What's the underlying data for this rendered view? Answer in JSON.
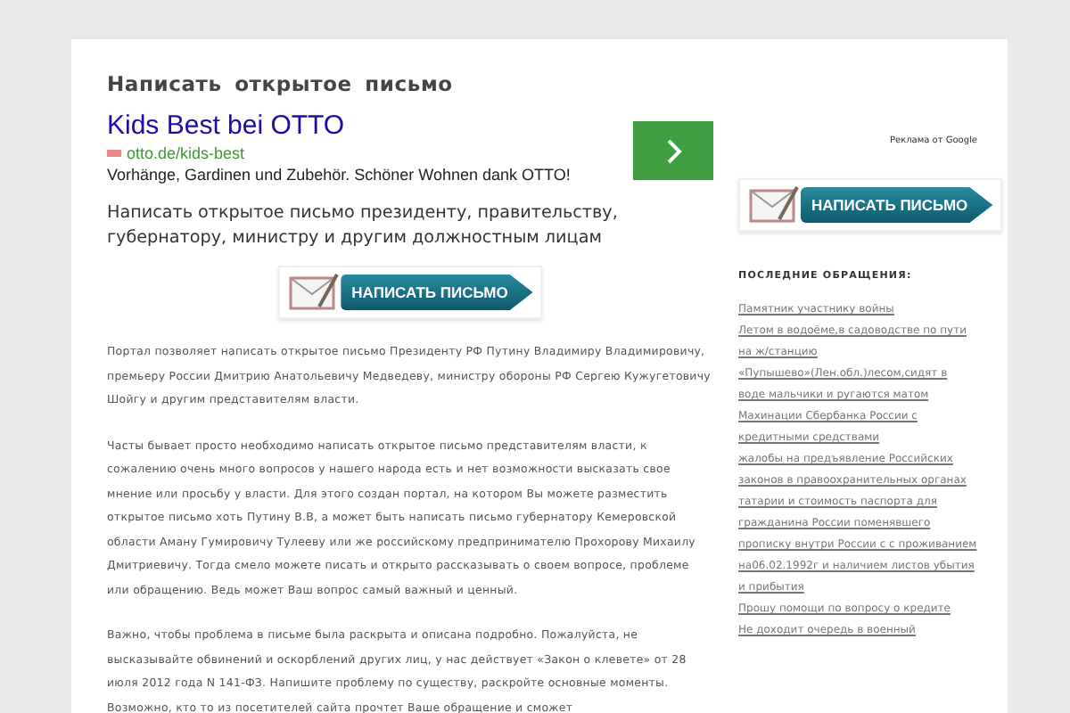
{
  "page_title": "Написать открытое письмо",
  "ad": {
    "headline": "Kids Best bei OTTO",
    "url": "otto.de/kids-best",
    "text": "Vorhänge, Gardinen und Zubehör. Schöner Wohnen dank OTTO!",
    "attribution": "Реклама от Google"
  },
  "subtitle": "Написать открытое письмо президенту, правительству, губернатору, министру и другим должностным лицам",
  "write_button": "НАПИСАТЬ ПИСЬМО",
  "paragraphs": [
    "Портал позволяет написать открытое письмо Президенту РФ Путину Владимиру Владимировичу, премьеру России Дмитрию Анатольевичу Медведеву, министру обороны РФ Сергею Кужугетовичу Шойгу и другим представителям власти.",
    "Часты бывает просто необходимо написать открытое письмо представителям власти, к сожалению очень много вопросов у нашего народа есть и нет возможности высказать свое мнение или просьбу у власти. Для этого создан портал, на котором Вы можете разместить открытое письмо хоть Путину В.В, а может быть написать письмо губернатору Кемеровской области Аману Гумировичу Тулееву или же российскому предпринимателю Прохорову Михаилу Дмитриевичу. Тогда смело можете писать и открыто рассказывать о своем вопросе, проблеме или обращению. Ведь может Ваш вопрос самый важный и ценный.",
    "Важно, чтобы проблема в письме была раскрыта и описана подробно. Пожалуйста, не высказывайте обвинений и оскорблений других лиц, у нас действует «Закон о клевете» от 28 июля 2012 года N 141-ФЗ. Напишите проблему по существу, раскройте основные моменты. Возможно, кто то из посетителей сайта прочтет Ваше обращение и сможет"
  ],
  "sidebar": {
    "write_button": "НАПИСАТЬ ПИСЬМО",
    "heading": "ПОСЛЕДНИЕ ОБРАЩЕНИЯ:",
    "links": [
      "Памятник участнику войны",
      "Летом в водоёме,в садоводстве по пути на ж/станцию «Пупышево»(Лен.обл.)лесом,сидят в воде мальчики и ругаются матом",
      "Махинации Сбербанка России с кредитными средствами",
      "жалобы на предъявление Российских законов в правоохранительных органах татарии и стоимость паспорта для гражданина России поменявшего прописку внутри России с с проживанием на06.02.1992г и наличием листов убытия и прибытия",
      "Прошу помощи по вопросу о кредите",
      "Не доходит очередь в военный"
    ]
  }
}
